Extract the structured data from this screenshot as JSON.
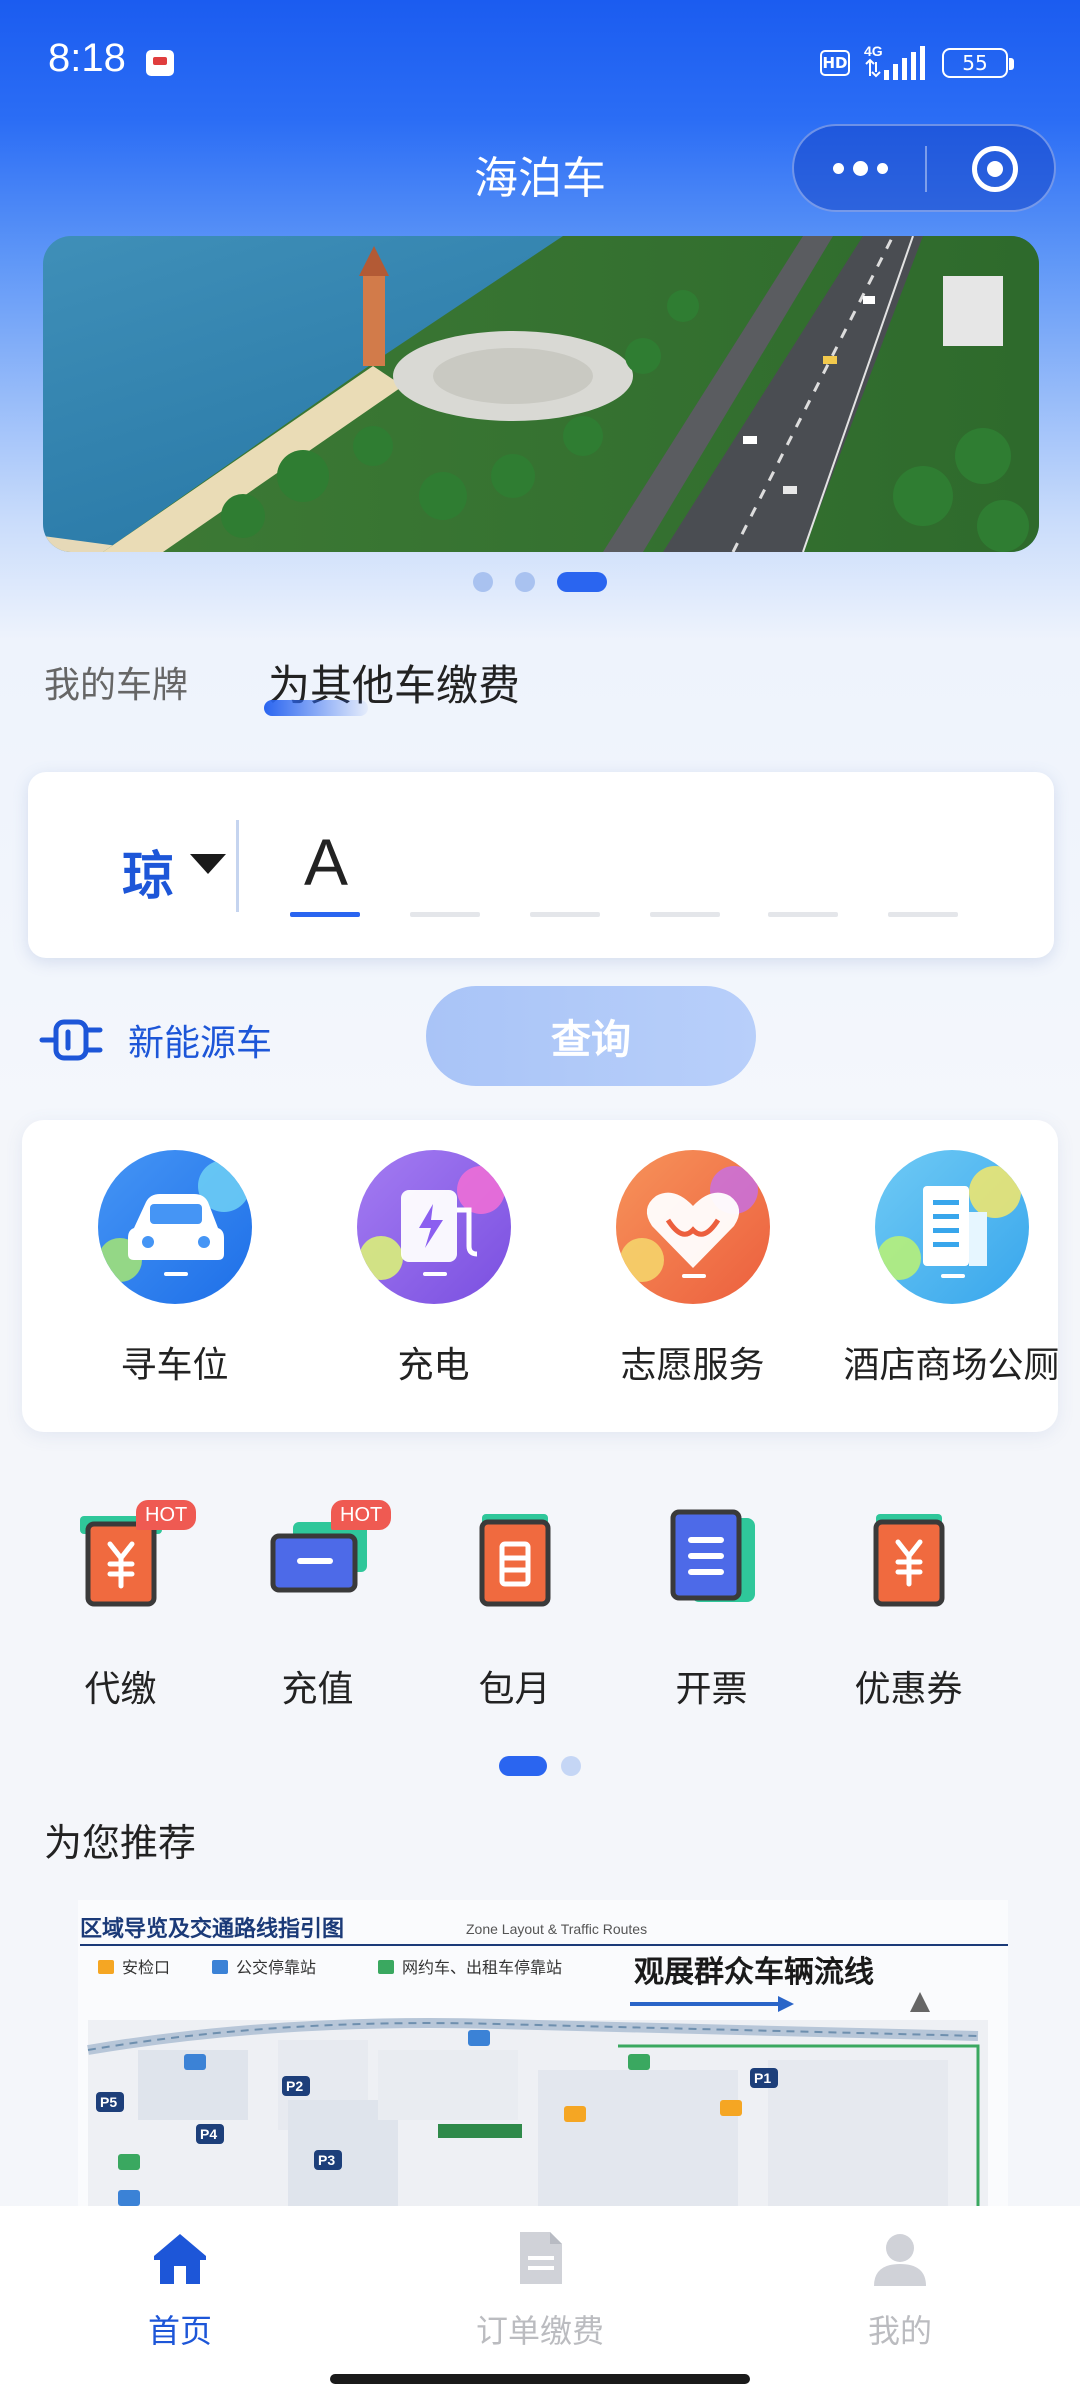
{
  "status_bar": {
    "time": "8:18",
    "network": "4G",
    "hd": "HD",
    "battery": "55"
  },
  "nav": {
    "title": "海泊车"
  },
  "banner": {
    "slide_count": 3,
    "active_index": 2
  },
  "plate_tabs": {
    "mine": "我的车牌",
    "other": "为其他车缴费",
    "active": "other"
  },
  "plate": {
    "province": "琼",
    "chars": [
      "A",
      "",
      "",
      "",
      "",
      ""
    ]
  },
  "ev": {
    "label": "新能源车"
  },
  "query_button": "查询",
  "services": [
    {
      "label": "寻车位",
      "icon": "car-icon",
      "color": "#2b7bf0"
    },
    {
      "label": "充电",
      "icon": "charging-icon",
      "color": "#8f63e6"
    },
    {
      "label": "志愿服务",
      "icon": "volunteer-heart-icon",
      "color": "#f0774d"
    },
    {
      "label": "酒店商场公厕",
      "icon": "building-icon",
      "color": "#52b9f2"
    }
  ],
  "quick_actions": [
    {
      "label": "代缴",
      "icon": "pay-for-others-icon",
      "badge": "HOT"
    },
    {
      "label": "充值",
      "icon": "recharge-card-icon",
      "badge": "HOT"
    },
    {
      "label": "包月",
      "icon": "monthly-pass-icon",
      "badge": ""
    },
    {
      "label": "开票",
      "icon": "invoice-icon",
      "badge": ""
    },
    {
      "label": "优惠券",
      "icon": "coupon-icon",
      "badge": ""
    }
  ],
  "quick_action_pages": {
    "count": 2,
    "active_index": 0
  },
  "recommend": {
    "title": "为您推荐",
    "map": {
      "title": "区域导览及交通路线指引图",
      "subtitle": "Zone Layout & Traffic Routes",
      "legend": [
        "安检口",
        "公交停靠站",
        "网约车、出租车停靠站"
      ],
      "headline": "观展群众车辆流线",
      "zones": [
        "P1",
        "P2",
        "P3",
        "P4",
        "P5"
      ]
    }
  },
  "bottom_nav": [
    {
      "label": "首页",
      "icon": "home-icon",
      "active": true
    },
    {
      "label": "订单缴费",
      "icon": "order-document-icon",
      "active": false
    },
    {
      "label": "我的",
      "icon": "profile-icon",
      "active": false
    }
  ]
}
